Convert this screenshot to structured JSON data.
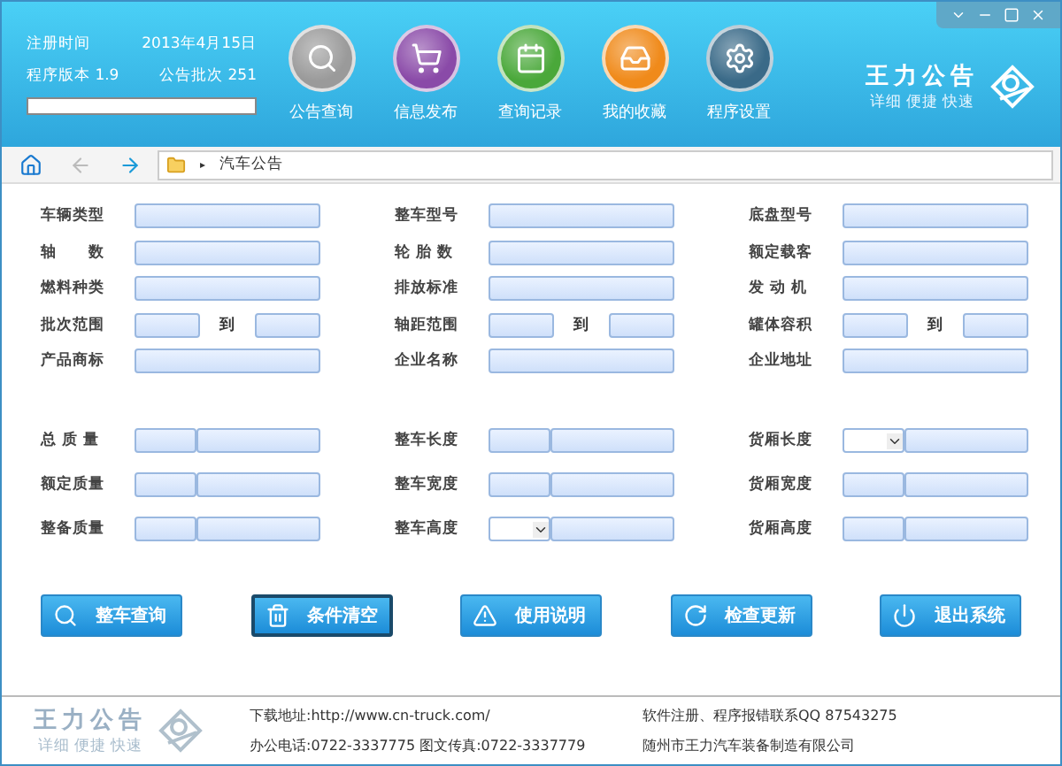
{
  "header": {
    "info": [
      {
        "label": "注册时间",
        "value": "2013年4月15日"
      },
      {
        "label": "程序版本  1.9",
        "value": "公告批次  251"
      }
    ],
    "progress": {
      "level": 0
    },
    "tools": [
      {
        "label": "公告查询"
      },
      {
        "label": "信息发布"
      },
      {
        "label": "查询记录"
      },
      {
        "label": "我的收藏"
      },
      {
        "label": "程序设置"
      }
    ],
    "brand": {
      "name": "王力公告",
      "slogan": "详细 便捷 快速"
    }
  },
  "nav": {
    "path": "汽车公告",
    "separator": "▸"
  },
  "form_top": [
    [
      {
        "label": "车辆类型",
        "kind": "text"
      },
      {
        "label": "整车型号",
        "kind": "text"
      },
      {
        "label": "底盘型号",
        "kind": "text"
      }
    ],
    [
      {
        "label": "轴      数",
        "kind": "text"
      },
      {
        "label": "轮 胎 数",
        "kind": "text"
      },
      {
        "label": "额定载客",
        "kind": "text"
      }
    ],
    [
      {
        "label": "燃料种类",
        "kind": "text"
      },
      {
        "label": "排放标准",
        "kind": "text"
      },
      {
        "label": "发 动 机",
        "kind": "text"
      }
    ],
    [
      {
        "label": "批次范围",
        "kind": "range",
        "to": "到"
      },
      {
        "label": "轴距范围",
        "kind": "range",
        "to": "到"
      },
      {
        "label": "罐体容积",
        "kind": "range",
        "to": "到"
      }
    ],
    [
      {
        "label": "产品商标",
        "kind": "text"
      },
      {
        "label": "企业名称",
        "kind": "text"
      },
      {
        "label": "企业地址",
        "kind": "text"
      }
    ]
  ],
  "form_bottom": [
    [
      {
        "label": "总 质 量",
        "kind": "pair"
      },
      {
        "label": "整车长度",
        "kind": "pair"
      },
      {
        "label": "货厢长度",
        "kind": "select_pair"
      }
    ],
    [
      {
        "label": "额定质量",
        "kind": "pair"
      },
      {
        "label": "整车宽度",
        "kind": "pair"
      },
      {
        "label": "货厢宽度",
        "kind": "pair"
      }
    ],
    [
      {
        "label": "整备质量",
        "kind": "pair"
      },
      {
        "label": "整车高度",
        "kind": "select_pair"
      },
      {
        "label": "货厢高度",
        "kind": "pair"
      }
    ]
  ],
  "buttons": [
    {
      "label": "整车查询",
      "selected": false
    },
    {
      "label": "条件清空",
      "selected": true
    },
    {
      "label": "使用说明",
      "selected": false
    },
    {
      "label": "检查更新",
      "selected": false
    },
    {
      "label": "退出系统",
      "selected": false
    }
  ],
  "footer": {
    "brand": {
      "name": "王力公告",
      "slogan": "详细 便捷 快速"
    },
    "lines": [
      [
        "下载地址:http://www.cn-truck.com/",
        "办公电话:0722-3337775 图文传真:0722-3337779"
      ],
      [
        "软件注册、程序报错联系QQ 87543275",
        "随州市王力汽车装备制造有限公司"
      ]
    ]
  }
}
